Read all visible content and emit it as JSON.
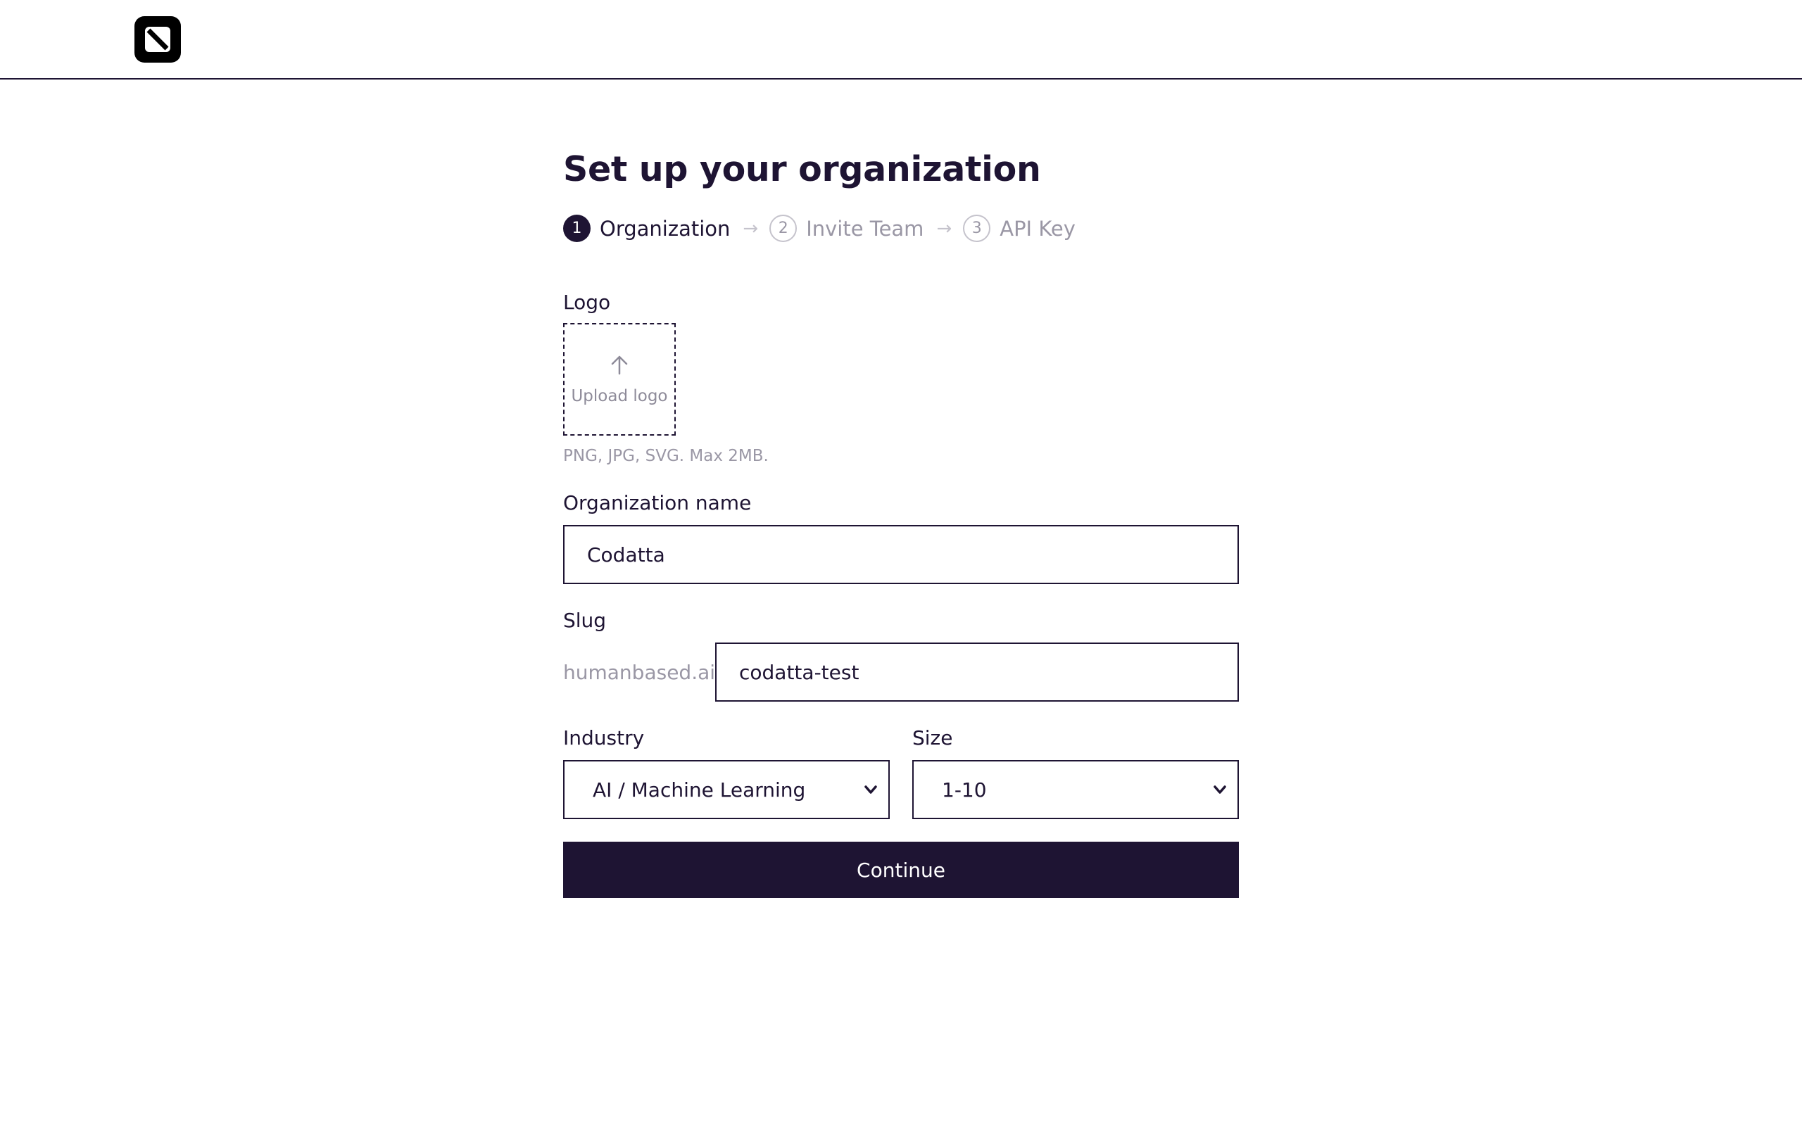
{
  "header": {
    "logo_icon": "app-logo-icon"
  },
  "page": {
    "title": "Set up your organization"
  },
  "steps": [
    {
      "number": "1",
      "label": "Organization",
      "state": "active"
    },
    {
      "number": "2",
      "label": "Invite Team",
      "state": "inactive"
    },
    {
      "number": "3",
      "label": "API Key",
      "state": "inactive"
    }
  ],
  "form": {
    "logo": {
      "label": "Logo",
      "upload_text": "Upload logo",
      "upload_icon": "arrow-up-icon",
      "hint": "PNG, JPG, SVG. Max 2MB."
    },
    "org_name": {
      "label": "Organization name",
      "value": "Codatta"
    },
    "slug": {
      "label": "Slug",
      "prefix": "humanbased.ai/",
      "value": "codatta-test"
    },
    "industry": {
      "label": "Industry",
      "value": "AI / Machine Learning"
    },
    "size": {
      "label": "Size",
      "value": "1-10"
    },
    "continue_label": "Continue"
  },
  "colors": {
    "primary": "#1e1433",
    "muted": "#9a97a5",
    "background": "#ffffff"
  }
}
